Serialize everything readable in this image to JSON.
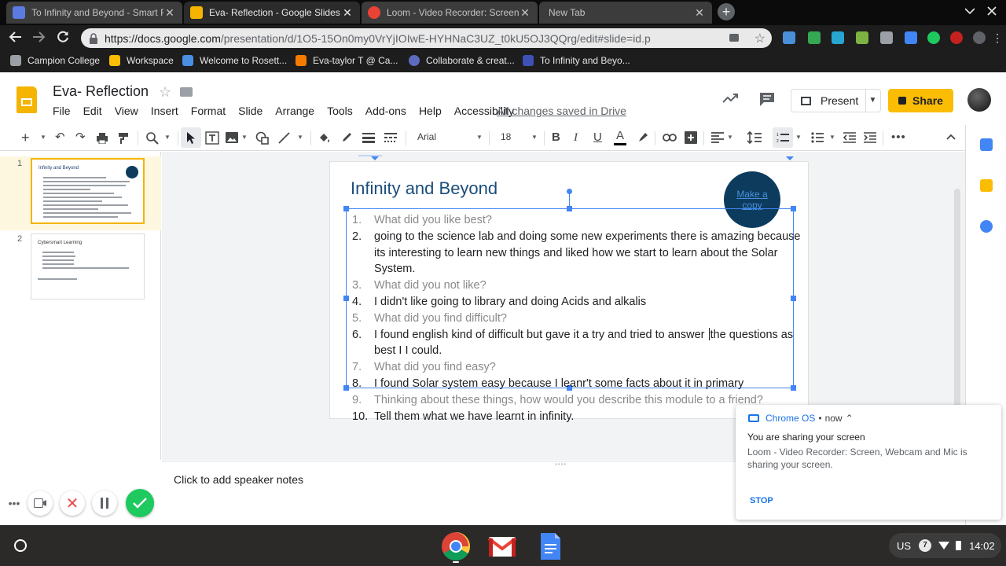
{
  "browser": {
    "tabs": [
      {
        "title": "To Infinity and Beyond - Smart F",
        "favicon_color": "#5b7be0",
        "active": false
      },
      {
        "title": "Eva- Reflection - Google Slides",
        "favicon_color": "#f4b400",
        "active": true
      },
      {
        "title": "Loom - Video Recorder: Screen,",
        "favicon_color": "#ea4335",
        "active": false
      },
      {
        "title": "New Tab",
        "favicon_color": "",
        "active": false
      }
    ],
    "tab_close_glyph": "✕",
    "new_tab_glyph": "+",
    "url_host": "https://docs.google.com",
    "url_path": "/presentation/d/1O5-15On0my0VrYjIOIwE-HYHNaC3UZ_t0kU5OJ3QQrg/edit#slide=id.p",
    "bookmarks": [
      {
        "label": "Campion College",
        "icon_color": "#9aa0a6"
      },
      {
        "label": "Workspace",
        "icon_color": "#fbbc04"
      },
      {
        "label": "Welcome to Rosett...",
        "icon_color": "#4a90e2"
      },
      {
        "label": "Eva-taylor T @ Ca...",
        "icon_color": "#f57c00"
      },
      {
        "label": "Collaborate & creat...",
        "icon_color": "#5c6bc0"
      },
      {
        "label": "To Infinity and Beyo...",
        "icon_color": "#3f51b5"
      }
    ]
  },
  "slides_app": {
    "doc_title": "Eva- Reflection",
    "menu": [
      "File",
      "Edit",
      "View",
      "Insert",
      "Format",
      "Slide",
      "Arrange",
      "Tools",
      "Add-ons",
      "Help",
      "Accessibility"
    ],
    "save_status": "All changes saved in Drive",
    "present_label": "Present",
    "share_label": "Share",
    "toolbar": {
      "font": "Arial",
      "font_size": "18"
    },
    "speaker_notes_placeholder": "Click to add speaker notes"
  },
  "filmstrip": {
    "slides": [
      {
        "number": "1",
        "title": "Infinity and Beyond"
      },
      {
        "number": "2",
        "title": "Cybersmart Learning"
      }
    ]
  },
  "slide": {
    "title": "Infinity and Beyond",
    "copy_button": "Make a copy",
    "items": [
      {
        "n": "1.",
        "text": "What did you like best?",
        "kind": "q"
      },
      {
        "n": "2.",
        "text": " going to the science lab and doing some new experiments there is amazing because its interesting to learn new things  and liked how we start to learn about the Solar System.",
        "kind": "a"
      },
      {
        "n": "3.",
        "text": "What did you not like?",
        "kind": "q"
      },
      {
        "n": "4.",
        "text": "I didn't like going to library and doing Acids and  alkalis",
        "kind": "a"
      },
      {
        "n": "5.",
        "text": "What did you find difficult?",
        "kind": "q"
      },
      {
        "n": "6.",
        "text_before_caret": "I found english kind of difficult but gave it a try and tried to answer ",
        "text_after_caret": "the questions as best I I could.",
        "kind": "a"
      },
      {
        "n": "7.",
        "text": "What did you find easy?",
        "kind": "q"
      },
      {
        "n": "8.",
        "text": "I found Solar system easy because I leanr't some facts about it in primary",
        "kind": "a"
      },
      {
        "n": "9.",
        "text": "Thinking about these things, how would you describe this module to a friend?",
        "kind": "q"
      },
      {
        "n": "10.",
        "text": "Tell them what we have learnt in infinity.",
        "kind": "a"
      }
    ]
  },
  "notification": {
    "source": "Chrome OS",
    "separator": "•",
    "time": "now",
    "chevron": "⌃",
    "heading": "You are sharing your screen",
    "body": "Loom - Video Recorder: Screen, Webcam and Mic is sharing your screen.",
    "action": "STOP"
  },
  "shelf": {
    "ime": "US",
    "notification_count": "7",
    "time": "14:02"
  },
  "colors": {
    "slides_yellow": "#f4b400",
    "share_yellow": "#fbbc04",
    "selection_blue": "#4285f4",
    "title_blue": "#1a4d7a",
    "loom_green": "#1ec95f"
  }
}
